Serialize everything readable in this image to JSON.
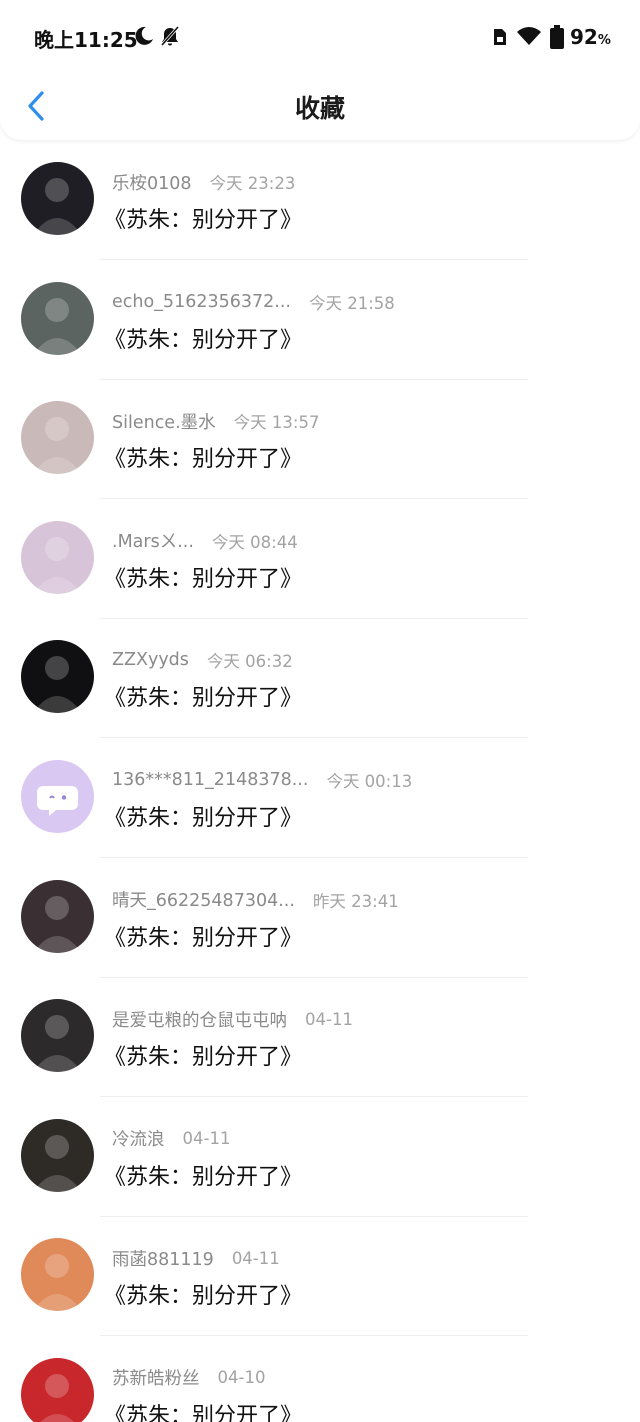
{
  "status": {
    "time": "晚上11:25",
    "battery": "92",
    "battery_unit": "%",
    "icons": [
      "moon-icon",
      "bell-muted-icon",
      "sim-icon",
      "wifi-icon",
      "battery-icon"
    ]
  },
  "header": {
    "title": "收藏",
    "back_icon": "chevron-left-icon",
    "accent_color": "#2f8eea"
  },
  "favorites": [
    {
      "user": "乐桉0108",
      "time": "今天 23:23",
      "title": "《苏朱：别分开了》",
      "avatar_color": "#1e1e24"
    },
    {
      "user": "echo_5162356372...",
      "time": "今天 21:58",
      "title": "《苏朱：别分开了》",
      "avatar_color": "#5c6461"
    },
    {
      "user": "Silence.墨水",
      "time": "今天 13:57",
      "title": "《苏朱：别分开了》",
      "avatar_color": "#c9b9b8"
    },
    {
      "user": ".Marsㄨ...",
      "time": "今天 08:44",
      "title": "《苏朱：别分开了》",
      "avatar_color": "#d8c4d8"
    },
    {
      "user": "ZZXyyds",
      "time": "今天 06:32",
      "title": "《苏朱：别分开了》",
      "avatar_color": "#101012"
    },
    {
      "user": "136***811_2148378...",
      "time": "今天 00:13",
      "title": "《苏朱：别分开了》",
      "avatar_color": "#d9c8f2"
    },
    {
      "user": "晴天_66225487304...",
      "time": "昨天 23:41",
      "title": "《苏朱：别分开了》",
      "avatar_color": "#3a3034"
    },
    {
      "user": "是爱屯粮的仓鼠屯屯呐",
      "time": "04-11",
      "title": "《苏朱：别分开了》",
      "avatar_color": "#2c2a2a"
    },
    {
      "user": "冷流浪",
      "time": "04-11",
      "title": "《苏朱：别分开了》",
      "avatar_color": "#2e2a26"
    },
    {
      "user": "雨菡881119",
      "time": "04-11",
      "title": "《苏朱：别分开了》",
      "avatar_color": "#e08a5a"
    },
    {
      "user": "苏新皓粉丝",
      "time": "04-10",
      "title": "《苏朱：别分开了》",
      "avatar_color": "#c8282c"
    }
  ]
}
